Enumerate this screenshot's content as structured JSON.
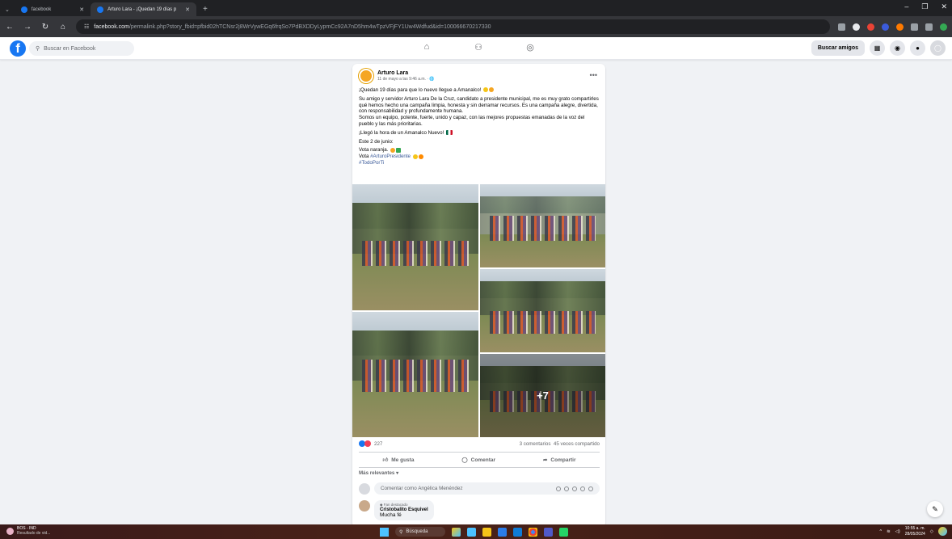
{
  "browser": {
    "tabs": [
      {
        "title": "facebook",
        "active": false
      },
      {
        "title": "Arturo Lara - ¡Quedan 19 días p",
        "active": true
      }
    ],
    "url_host": "facebook.com",
    "url_path": "/permalink.php?story_fbid=pfbid02hTCNsr2j8WrVywEGq6frqSo7PdBXDDyLypmCc92A7nD5hm4wTpzVFjFY1Uw4Wdfud&id=100066670217330"
  },
  "fb": {
    "search_placeholder": "Buscar en Facebook",
    "find_friends": "Buscar amigos",
    "icons": [
      "home-icon",
      "friends-icon",
      "groups-icon"
    ]
  },
  "post": {
    "author": "Arturo Lara",
    "meta": "11 de mayo a las 9:46 a.m. · 🌐",
    "headline": "¡Quedan 19 días para que lo nuevo llegue a Amanalco!",
    "body1": "Su amigo y servidor Arturo Lara De la Cruz, candidato a presidente municipal, me es muy grato compartirles qué hemos hecho una campaña limpia, honesta y sin derramar recursos. Es una campaña alegre, divertida, con responsabilidad y profundamente humana.",
    "body2": "Somos un equipo, potente, fuerte, unido y capaz, con las mejores propuestas emanadas de la voz del pueblo y las más prioritarias.",
    "line_llego": "¡Llegó la hora de un Amanalco Nuevo!",
    "line_junio": "Este 2 de junio:",
    "line_vota1": "Vota naranja.",
    "line_vota2_prefix": "Vota ",
    "hashtag1": "#ArturoPresidente",
    "hashtag2": "#TodoPorTi",
    "more_photos": "+7",
    "reactions_count": "227",
    "comments_count": "3 comentarios",
    "shares_count": "45 veces compartido",
    "like_label": "Me gusta",
    "comment_label": "Comentar",
    "share_label": "Compartir",
    "sort_label": "Más relevantes ▾",
    "comment_placeholder": "Comentar como Angélica Menéndez"
  },
  "comment": {
    "badge": "Fan destacado",
    "name": "Cristobalito Esquivel",
    "text": "Mucha fé"
  },
  "taskbar": {
    "weather_title": "BOS - IND",
    "weather_sub": "Resultado de vid...",
    "search": "Búsqueda",
    "time": "10:55 a. m.",
    "date": "28/05/2024"
  },
  "colors": {
    "fb_blue": "#1877f2",
    "page_bg": "#f0f2f5"
  }
}
